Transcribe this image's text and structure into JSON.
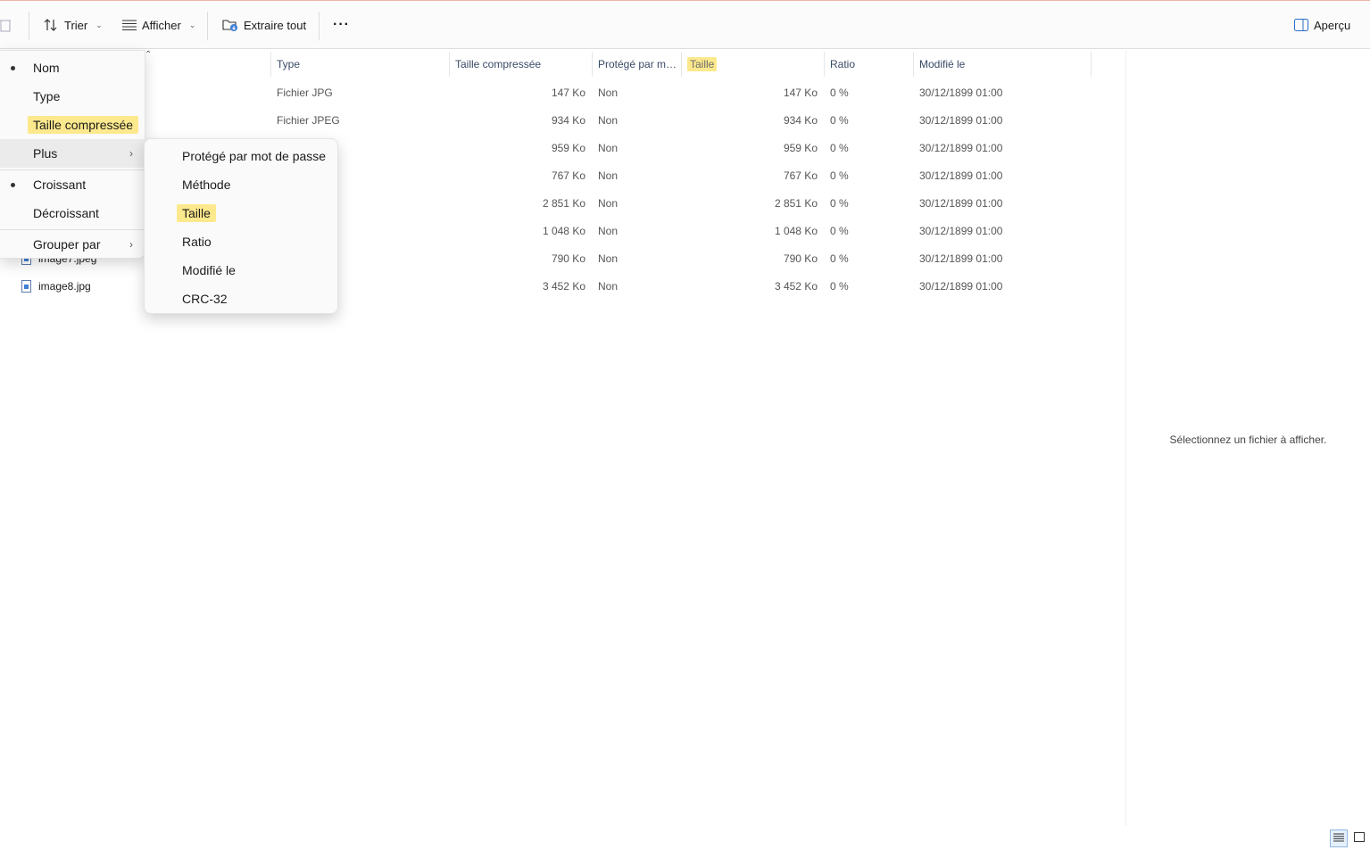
{
  "toolbar": {
    "sort_label": "Trier",
    "view_label": "Afficher",
    "extract_label": "Extraire tout",
    "more_label": "···",
    "preview_label": "Aperçu"
  },
  "columns": {
    "type": "Type",
    "compressed": "Taille compressée",
    "protected": "Protégé par m…",
    "size": "Taille",
    "ratio": "Ratio",
    "modified": "Modifié le"
  },
  "rows": [
    {
      "name": "",
      "type": "Fichier JPG",
      "compressed": "147 Ko",
      "protected": "Non",
      "size": "147 Ko",
      "ratio": "0 %",
      "modified": "30/12/1899 01:00"
    },
    {
      "name": "",
      "type": "Fichier JPEG",
      "compressed": "934 Ko",
      "protected": "Non",
      "size": "934 Ko",
      "ratio": "0 %",
      "modified": "30/12/1899 01:00"
    },
    {
      "name": "",
      "type": "",
      "compressed": "959 Ko",
      "protected": "Non",
      "size": "959 Ko",
      "ratio": "0 %",
      "modified": "30/12/1899 01:00"
    },
    {
      "name": "",
      "type": "",
      "compressed": "767 Ko",
      "protected": "Non",
      "size": "767 Ko",
      "ratio": "0 %",
      "modified": "30/12/1899 01:00"
    },
    {
      "name": "",
      "type": "",
      "compressed": "2 851 Ko",
      "protected": "Non",
      "size": "2 851 Ko",
      "ratio": "0 %",
      "modified": "30/12/1899 01:00"
    },
    {
      "name": "",
      "type": "",
      "compressed": "1 048 Ko",
      "protected": "Non",
      "size": "1 048 Ko",
      "ratio": "0 %",
      "modified": "30/12/1899 01:00"
    },
    {
      "name": "image7.jpeg",
      "type": "",
      "compressed": "790 Ko",
      "protected": "Non",
      "size": "790 Ko",
      "ratio": "0 %",
      "modified": "30/12/1899 01:00"
    },
    {
      "name": "image8.jpg",
      "type": "",
      "compressed": "3 452 Ko",
      "protected": "Non",
      "size": "3 452 Ko",
      "ratio": "0 %",
      "modified": "30/12/1899 01:00"
    }
  ],
  "sort_menu": {
    "nom": "Nom",
    "type": "Type",
    "compressed": "Taille compressée",
    "plus": "Plus",
    "asc": "Croissant",
    "desc": "Décroissant",
    "group": "Grouper par"
  },
  "sub_menu": {
    "protected": "Protégé par mot de passe",
    "method": "Méthode",
    "size": "Taille",
    "ratio": "Ratio",
    "modified": "Modifié le",
    "crc": "CRC-32"
  },
  "preview": {
    "message": "Sélectionnez un fichier à afficher."
  },
  "colors": {
    "highlight": "#fde98d",
    "header_text": "#3a4a66",
    "accent": "#3f7fd4"
  }
}
